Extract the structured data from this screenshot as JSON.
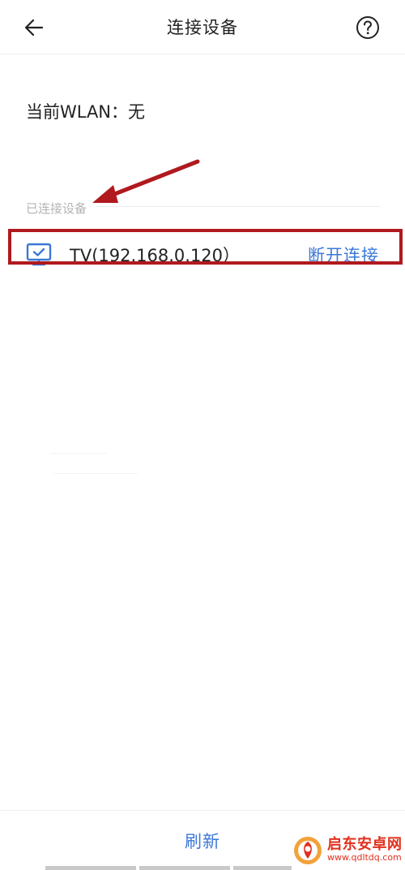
{
  "header": {
    "back_icon": "arrow-left-icon",
    "title": "连接设备",
    "help_icon": "question-circle-icon"
  },
  "wlan": {
    "text": "当前WLAN：无"
  },
  "connected_section": {
    "label": "已连接设备"
  },
  "device": {
    "icon": "monitor-check-icon",
    "name": "TV(192.168.0.120）",
    "action_label": "断开连接"
  },
  "bottom": {
    "refresh_label": "刷新"
  },
  "watermark": {
    "title": "启东安卓网",
    "url": "www.qdltdq.com"
  },
  "colors": {
    "accent": "#3b78d8",
    "highlight": "#b0191e",
    "muted": "#b4b4b4",
    "watermark": "#e0301e"
  }
}
